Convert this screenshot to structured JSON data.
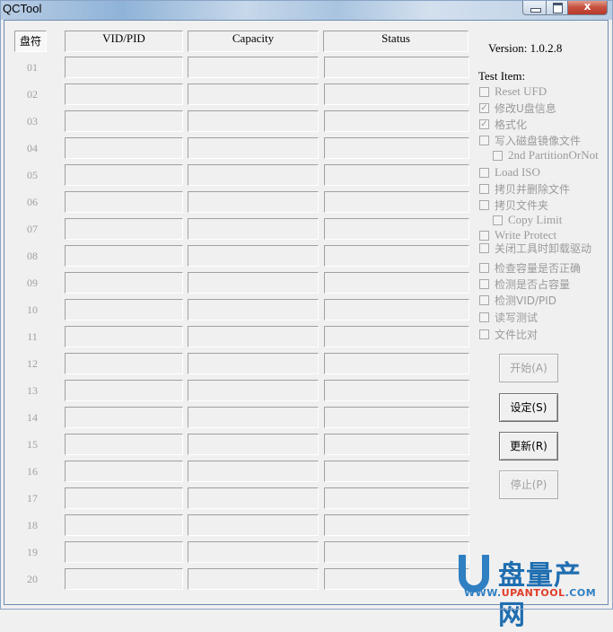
{
  "window": {
    "title": "QCTool",
    "controls": {
      "minimize": "minimize",
      "maximize": "maximize",
      "close": "x"
    }
  },
  "grid": {
    "drive_header": "盘符",
    "columns": [
      "VID/PID",
      "Capacity",
      "Status"
    ],
    "rows": [
      {
        "num": "01",
        "vid_pid": "",
        "capacity": "",
        "status": ""
      },
      {
        "num": "02",
        "vid_pid": "",
        "capacity": "",
        "status": ""
      },
      {
        "num": "03",
        "vid_pid": "",
        "capacity": "",
        "status": ""
      },
      {
        "num": "04",
        "vid_pid": "",
        "capacity": "",
        "status": ""
      },
      {
        "num": "05",
        "vid_pid": "",
        "capacity": "",
        "status": ""
      },
      {
        "num": "06",
        "vid_pid": "",
        "capacity": "",
        "status": ""
      },
      {
        "num": "07",
        "vid_pid": "",
        "capacity": "",
        "status": ""
      },
      {
        "num": "08",
        "vid_pid": "",
        "capacity": "",
        "status": ""
      },
      {
        "num": "09",
        "vid_pid": "",
        "capacity": "",
        "status": ""
      },
      {
        "num": "10",
        "vid_pid": "",
        "capacity": "",
        "status": ""
      },
      {
        "num": "11",
        "vid_pid": "",
        "capacity": "",
        "status": ""
      },
      {
        "num": "12",
        "vid_pid": "",
        "capacity": "",
        "status": ""
      },
      {
        "num": "13",
        "vid_pid": "",
        "capacity": "",
        "status": ""
      },
      {
        "num": "14",
        "vid_pid": "",
        "capacity": "",
        "status": ""
      },
      {
        "num": "15",
        "vid_pid": "",
        "capacity": "",
        "status": ""
      },
      {
        "num": "16",
        "vid_pid": "",
        "capacity": "",
        "status": ""
      },
      {
        "num": "17",
        "vid_pid": "",
        "capacity": "",
        "status": ""
      },
      {
        "num": "18",
        "vid_pid": "",
        "capacity": "",
        "status": ""
      },
      {
        "num": "19",
        "vid_pid": "",
        "capacity": "",
        "status": ""
      },
      {
        "num": "20",
        "vid_pid": "",
        "capacity": "",
        "status": ""
      }
    ]
  },
  "side": {
    "version": "Version: 1.0.2.8",
    "test_item_label": "Test Item:",
    "test_items": [
      {
        "label": "Reset UFD",
        "checked": false,
        "indent": false
      },
      {
        "label": "修改U盘信息",
        "checked": true,
        "indent": false
      },
      {
        "label": "格式化",
        "checked": true,
        "indent": false
      },
      {
        "label": "写入磁盘镜像文件",
        "checked": false,
        "indent": false
      },
      {
        "label": "2nd PartitionOrNot",
        "checked": false,
        "indent": true
      },
      {
        "label": "Load ISO",
        "checked": false,
        "indent": false
      },
      {
        "label": "拷贝并删除文件",
        "checked": false,
        "indent": false
      },
      {
        "label": "拷贝文件夹",
        "checked": false,
        "indent": false
      },
      {
        "label": "Copy Limit",
        "checked": false,
        "indent": true
      },
      {
        "label": "Write Protect",
        "checked": false,
        "indent": false
      },
      {
        "label": "关闭工具时卸载驱动",
        "checked": false,
        "indent": false
      },
      {
        "label": "检查容量是否正确",
        "checked": false,
        "indent": false
      },
      {
        "label": "检测是否占容量",
        "checked": false,
        "indent": false
      },
      {
        "label": "检测VID/PID",
        "checked": false,
        "indent": false
      },
      {
        "label": "读写测试",
        "checked": false,
        "indent": false
      },
      {
        "label": "文件比对",
        "checked": false,
        "indent": false
      }
    ],
    "buttons": [
      {
        "label": "开始(A)",
        "enabled": false
      },
      {
        "label": "设定(S)",
        "enabled": true
      },
      {
        "label": "更新(R)",
        "enabled": true
      },
      {
        "label": "停止(P)",
        "enabled": false
      }
    ]
  },
  "watermark": {
    "brand_cn": "盘量产网",
    "url_prefix": "WWW.",
    "url_mid": "UPANTOOL",
    "url_suffix": ".COM"
  }
}
